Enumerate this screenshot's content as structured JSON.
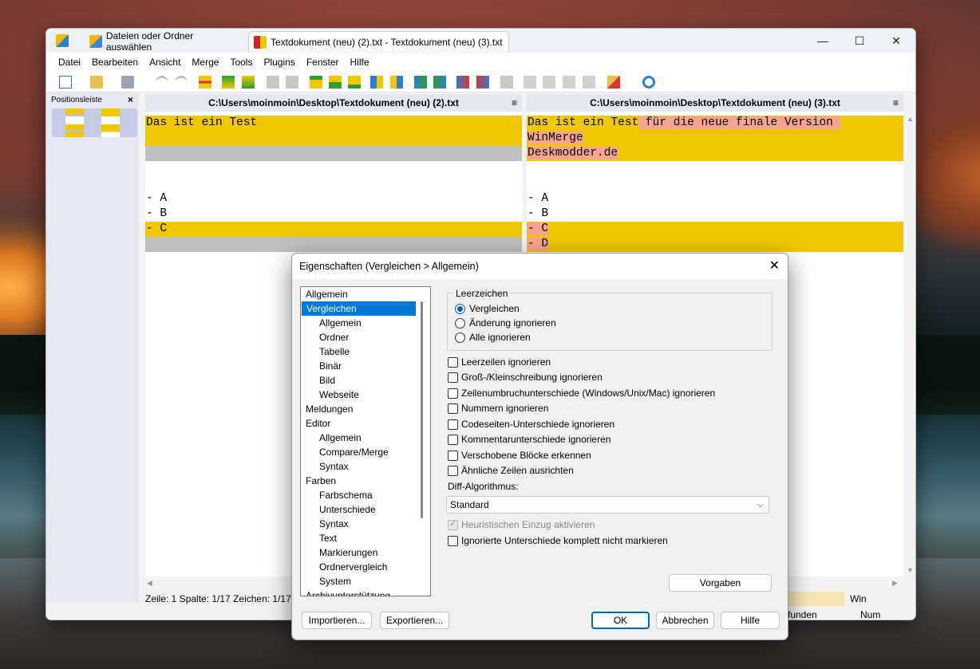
{
  "window": {
    "tabs": [
      {
        "label": "Dateien oder Ordner auswählen"
      },
      {
        "label": "Textdokument (neu) (2).txt - Textdokument (neu) (3).txt"
      }
    ],
    "controls": {
      "minimize": "—",
      "maximize": "☐",
      "close": "✕"
    }
  },
  "menu": [
    "Datei",
    "Bearbeiten",
    "Ansicht",
    "Merge",
    "Tools",
    "Plugins",
    "Fenster",
    "Hilfe"
  ],
  "location_pane": {
    "title": "Positionsleiste",
    "close": "×"
  },
  "left_pane": {
    "path": "C:\\Users\\moinmoin\\Desktop\\Textdokument (neu) (2).txt",
    "menu_icon": "≡",
    "lines": [
      "Das ist ein Test",
      "",
      "",
      "",
      "",
      "- A",
      "- B",
      "- C",
      ""
    ]
  },
  "right_pane": {
    "path": "C:\\Users\\moinmoin\\Desktop\\Textdokument (neu) (3).txt",
    "menu_icon": "≡",
    "line1_same": "Das ist ein Test",
    "line1_diff": " für die neue finale Version ",
    "lines": [
      "WinMerge",
      "Deskmodder.de",
      "",
      "",
      "- A",
      "- B",
      "- C",
      "- D"
    ]
  },
  "status": {
    "left": "Zeile: 1  Spalte: 1/17  Zeichen: 1/17",
    "right_top": "Win",
    "right_bottom_a": "funden",
    "right_bottom_b": "Num"
  },
  "dialog": {
    "title": "Eigenschaften (Vergleichen > Allgemein)",
    "close": "✕",
    "tree": [
      {
        "label": "Allgemein",
        "level": 1
      },
      {
        "label": "Vergleichen",
        "level": 1,
        "selected": true
      },
      {
        "label": "Allgemein",
        "level": 2
      },
      {
        "label": "Ordner",
        "level": 2
      },
      {
        "label": "Tabelle",
        "level": 2
      },
      {
        "label": "Binär",
        "level": 2
      },
      {
        "label": "Bild",
        "level": 2
      },
      {
        "label": "Webseite",
        "level": 2
      },
      {
        "label": "Meldungen",
        "level": 1
      },
      {
        "label": "Editor",
        "level": 1
      },
      {
        "label": "Allgemein",
        "level": 2
      },
      {
        "label": "Compare/Merge",
        "level": 2
      },
      {
        "label": "Syntax",
        "level": 2
      },
      {
        "label": "Farben",
        "level": 1
      },
      {
        "label": "Farbschema",
        "level": 2
      },
      {
        "label": "Unterschiede",
        "level": 2
      },
      {
        "label": "Syntax",
        "level": 2
      },
      {
        "label": "Text",
        "level": 2
      },
      {
        "label": "Markierungen",
        "level": 2
      },
      {
        "label": "Ordnervergleich",
        "level": 2
      },
      {
        "label": "System",
        "level": 2
      },
      {
        "label": "Archivunterstützung",
        "level": 1
      }
    ],
    "whitespace_group": "Leerzeichen",
    "radios": [
      {
        "label": "Vergleichen",
        "checked": true
      },
      {
        "label": "Änderung ignorieren",
        "checked": false
      },
      {
        "label": "Alle ignorieren",
        "checked": false
      }
    ],
    "checkboxes": [
      {
        "label": "Leerzeilen ignorieren",
        "checked": false
      },
      {
        "label": "Groß-/Kleinschreibung ignorieren",
        "checked": false
      },
      {
        "label": "Zeilenumbruchunterschiede (Windows/Unix/Mac) ignorieren",
        "checked": false
      },
      {
        "label": "Nummern ignorieren",
        "checked": false
      },
      {
        "label": "Codeseiten-Unterschiede ignorieren",
        "checked": false
      },
      {
        "label": "Kommentarunterschiede ignorieren",
        "checked": false
      },
      {
        "label": "Verschobene Blöcke erkennen",
        "checked": false
      },
      {
        "label": "Ähnliche Zeilen ausrichten",
        "checked": false
      }
    ],
    "algo_label": "Diff-Algorithmus:",
    "algo_value": "Standard",
    "heuristic": {
      "label": "Heuristischen Einzug aktivieren",
      "checked": true,
      "disabled": true
    },
    "ignore_mark": {
      "label": "Ignorierte Unterschiede komplett nicht markieren",
      "checked": false
    },
    "buttons": {
      "defaults": "Vorgaben",
      "import": "Importieren...",
      "export": "Exportieren...",
      "ok": "OK",
      "cancel": "Abbrechen",
      "help": "Hilfe"
    }
  },
  "colors": {
    "diff_yellow": "#f0c800",
    "word_diff": "#f7a58c",
    "missing_gray": "#c0c0c0",
    "selection": "#0078d7"
  }
}
